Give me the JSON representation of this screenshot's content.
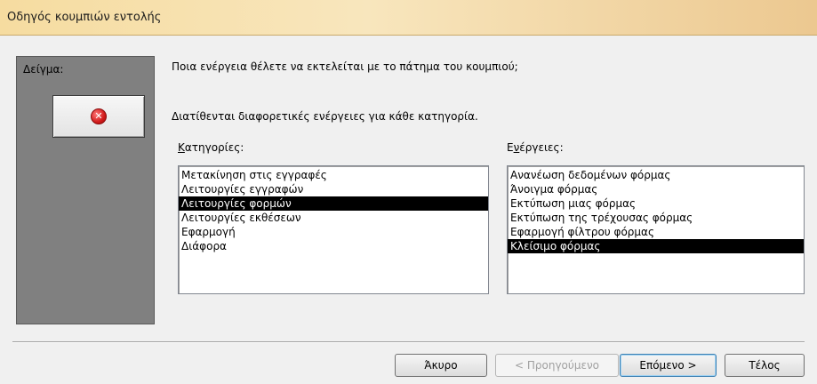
{
  "window": {
    "title": "Οδηγός κουμπιών εντολής"
  },
  "preview": {
    "label": "Δείγμα:",
    "icon": "stop-icon",
    "icon_glyph": "✕"
  },
  "prompt": {
    "question": "Ποια ενέργεια θέλετε να εκτελείται με το πάτημα του κουμπιού;",
    "info": "Διατίθενται διαφορετικές ενέργειες για κάθε κατηγορία."
  },
  "categories": {
    "label_underlined": "Κ",
    "label_rest": "ατηγορίες:",
    "items": [
      "Μετακίνηση στις εγγραφές",
      "Λειτουργίες εγγραφών",
      "Λειτουργίες φορμών",
      "Λειτουργίες εκθέσεων",
      "Εφαρμογή",
      "Διάφορα"
    ],
    "selected_index": 2
  },
  "actions": {
    "label_pre": "Ε",
    "label_underlined": "ν",
    "label_rest": "έργειες:",
    "items": [
      "Ανανέωση δεδομένων φόρμας",
      "Άνοιγμα φόρμας",
      "Εκτύπωση μιας φόρμας",
      "Εκτύπωση της τρέχουσας φόρμας",
      "Εφαρμογή φίλτρου φόρμας",
      "Κλείσιμο φόρμας"
    ],
    "selected_index": 5
  },
  "buttons": {
    "cancel": "Άκυρο",
    "back": "< Προηγούμενο",
    "next": "Επόμενο >",
    "finish": "Τέλος"
  }
}
